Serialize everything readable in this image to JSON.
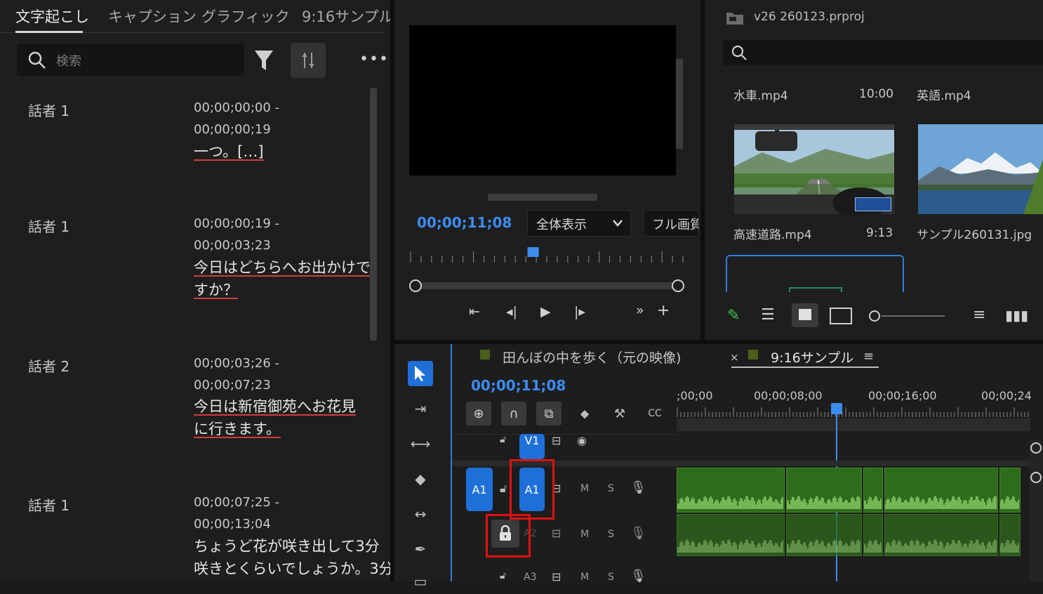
{
  "transcript": {
    "tabs": [
      "文字起こし",
      "キャプション",
      "グラフィック",
      "9:16サンプル"
    ],
    "search_placeholder": "検索",
    "entries": [
      {
        "speaker": "話者 1",
        "time_start": "00;00;00;00 -",
        "time_end": "00;00;00;19",
        "lines": [
          "一つ。[…]"
        ]
      },
      {
        "speaker": "話者 1",
        "time_start": "00;00;00;19 -",
        "time_end": "00;00;03;23",
        "lines": [
          "今日はどちらへお出かけで",
          "すか？"
        ]
      },
      {
        "speaker": "話者 2",
        "time_start": "00;00;03;26 -",
        "time_end": "00;00;07;23",
        "lines": [
          "今日は新宿御苑へお花見",
          "に行きます。"
        ]
      },
      {
        "speaker": "話者 1",
        "time_start": "00;00;07;25 -",
        "time_end": "00;00;13;04",
        "lines": [
          "ちょうど花が咲き出して3分",
          "咲きとくらいでしょうか。3分"
        ]
      }
    ]
  },
  "monitor": {
    "timecode": "00;00;11;08",
    "zoom_label": "全体表示",
    "quality_label": "フル画質",
    "playhead_fraction": 0.45
  },
  "project": {
    "title": "v26 260123.prproj",
    "items": [
      {
        "name": "水車.mp4",
        "duration": "10:00"
      },
      {
        "name": "英語.mp4",
        "duration": ""
      },
      {
        "name": "高速道路.mp4",
        "duration": "9:13"
      },
      {
        "name": "サンプル260131.jpg",
        "duration": ""
      }
    ]
  },
  "timeline": {
    "tabs": [
      "田んぼの中を歩く（元の映像)",
      "9:16サンプル"
    ],
    "close_glyph": "×",
    "menu_glyph": "≡",
    "timecode": "00;00;11;08",
    "ruler_labels": [
      ";00;00",
      "00;00;08;00",
      "00;00;16;00",
      "00;00;24"
    ],
    "tracks": {
      "v1": "V1",
      "a1_source": "A1",
      "a1": "A1",
      "a2": "A2",
      "a3": "A3",
      "mute": "M",
      "solo": "S"
    }
  },
  "colors": {
    "accent": "#1f6fd8",
    "timecode": "#3c8cf0",
    "clip": "#2e6b1c",
    "highlight": "#e01010"
  }
}
